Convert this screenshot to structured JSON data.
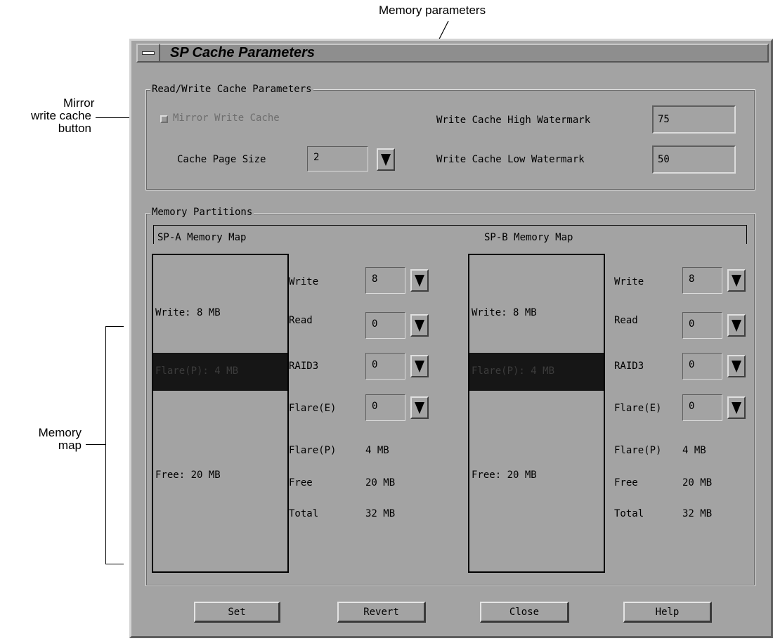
{
  "callouts": {
    "memory_parameters": "Memory parameters",
    "mirror_line1": "Mirror",
    "mirror_line2": "write cache",
    "mirror_line3": "button",
    "memory_map_line1": "Memory",
    "memory_map_line2": "map"
  },
  "window": {
    "title": "SP Cache Parameters"
  },
  "rw_cache": {
    "group_label": "Read/Write Cache Parameters",
    "mirror_label": "Mirror Write Cache",
    "mirror_checked": false,
    "mirror_enabled": false,
    "page_size_label": "Cache Page Size",
    "page_size_value": "2",
    "high_label": "Write Cache High Watermark",
    "high_value": "75",
    "low_label": "Write Cache Low Watermark",
    "low_value": "50"
  },
  "memory": {
    "group_label": "Memory Partitions",
    "sp_a": {
      "title": "SP-A Memory Map",
      "map_write": "Write: 8 MB",
      "map_flare": "Flare(P): 4 MB",
      "map_free": "Free: 20 MB",
      "write_label": "Write",
      "write_value": "8",
      "read_label": "Read",
      "read_value": "0",
      "raid3_label": "RAID3",
      "raid3_value": "0",
      "flare_e_label": "Flare(E)",
      "flare_e_value": "0",
      "flare_p_label": "Flare(P)",
      "flare_p_value": "4 MB",
      "free_label": "Free",
      "free_value": "20 MB",
      "total_label": "Total",
      "total_value": "32 MB"
    },
    "sp_b": {
      "title": "SP-B Memory Map",
      "map_write": "Write: 8 MB",
      "map_flare": "Flare(P): 4 MB",
      "map_free": "Free: 20 MB",
      "write_label": "Write",
      "write_value": "8",
      "read_label": "Read",
      "read_value": "0",
      "raid3_label": "RAID3",
      "raid3_value": "0",
      "flare_e_label": "Flare(E)",
      "flare_e_value": "0",
      "flare_p_label": "Flare(P)",
      "flare_p_value": "4 MB",
      "free_label": "Free",
      "free_value": "20 MB",
      "total_label": "Total",
      "total_value": "32 MB"
    }
  },
  "buttons": {
    "set": "Set",
    "revert": "Revert",
    "close": "Close",
    "help": "Help"
  },
  "icons": {
    "window_menu": "window-menu-icon",
    "dropdown": "triangle-down-icon",
    "checkbox": "checkbox-icon"
  }
}
